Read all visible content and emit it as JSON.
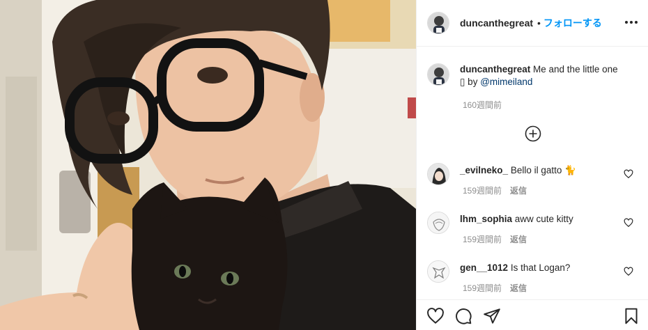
{
  "post": {
    "author": "duncanthegreat",
    "separator": "•",
    "follow_label": "フォローする",
    "more_icon": "more-horizontal-icon"
  },
  "caption": {
    "username": "duncanthegreat",
    "text_line1": "Me and the little one",
    "text_line2_prefix": "▯ by ",
    "mention": "@mimeiland",
    "time": "160週間前"
  },
  "load_more_icon": "plus-circle-icon",
  "comments": [
    {
      "username": "_evilneko_",
      "text": "Bello il gatto 🐈",
      "time": "159週間前",
      "reply": "返信"
    },
    {
      "username": "lhm_sophia",
      "text": "aww cute kitty",
      "time": "159週間前",
      "reply": "返信"
    },
    {
      "username": "gen__1012",
      "text": "Is that Logan?",
      "time": "159週間前",
      "reply": "返信"
    }
  ],
  "actions": [
    "heart-icon",
    "comment-icon",
    "share-icon",
    "bookmark-icon"
  ],
  "colors": {
    "link_blue": "#0095f6",
    "mention_blue": "#00376b",
    "secondary_text": "#8e8e8e",
    "primary_text": "#262626",
    "border": "#efefef"
  }
}
